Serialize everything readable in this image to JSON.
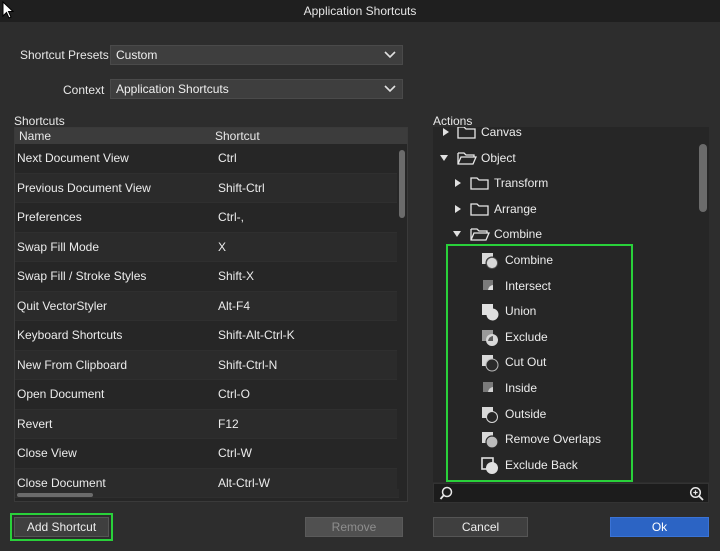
{
  "window": {
    "title": "Application Shortcuts"
  },
  "presets": {
    "label": "Shortcut Presets",
    "value": "Custom"
  },
  "context": {
    "label": "Context",
    "value": "Application Shortcuts"
  },
  "shortcuts": {
    "heading": "Shortcuts",
    "columns": [
      "Name",
      "Shortcut"
    ],
    "rows": [
      {
        "name": "Next Document View",
        "shortcut": "Ctrl"
      },
      {
        "name": "Previous Document View",
        "shortcut": "Shift-Ctrl"
      },
      {
        "name": "Preferences",
        "shortcut": "Ctrl-,"
      },
      {
        "name": "Swap Fill Mode",
        "shortcut": "X"
      },
      {
        "name": "Swap Fill / Stroke Styles",
        "shortcut": "Shift-X"
      },
      {
        "name": "Quit VectorStyler",
        "shortcut": "Alt-F4"
      },
      {
        "name": "Keyboard Shortcuts",
        "shortcut": "Shift-Alt-Ctrl-K"
      },
      {
        "name": "New From Clipboard",
        "shortcut": "Shift-Ctrl-N"
      },
      {
        "name": "Open Document",
        "shortcut": "Ctrl-O"
      },
      {
        "name": "Revert",
        "shortcut": "F12"
      },
      {
        "name": "Close View",
        "shortcut": "Ctrl-W"
      },
      {
        "name": "Close Document",
        "shortcut": "Alt-Ctrl-W"
      }
    ]
  },
  "actions": {
    "heading": "Actions",
    "groups": {
      "canvas": "Canvas",
      "object": "Object",
      "transform": "Transform",
      "arrange": "Arrange",
      "combine": "Combine"
    },
    "combine_items": [
      "Combine",
      "Intersect",
      "Union",
      "Exclude",
      "Cut Out",
      "Inside",
      "Outside",
      "Remove Overlaps",
      "Exclude Back"
    ],
    "search_placeholder": ""
  },
  "buttons": {
    "add_shortcut": "Add Shortcut",
    "remove": "Remove",
    "cancel": "Cancel",
    "ok": "Ok"
  },
  "colors": {
    "highlight": "#29d13a",
    "ok_button": "#2c64c4"
  }
}
